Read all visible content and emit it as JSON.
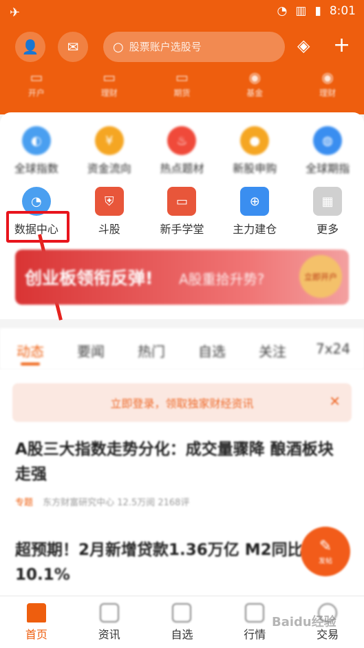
{
  "status_bar": {
    "time": "8:01"
  },
  "header": {
    "search_placeholder": "股票账户选股号"
  },
  "sub_nav": [
    {
      "label": "开户",
      "icon": "account-icon"
    },
    {
      "label": "理财",
      "icon": "wallet-icon"
    },
    {
      "label": "期货",
      "icon": "chart-icon"
    },
    {
      "label": "基金",
      "icon": "fund-icon"
    },
    {
      "label": "理财",
      "icon": "finance-icon"
    }
  ],
  "grid_row1": [
    {
      "label": "全球指数",
      "icon": "globe-chart-icon",
      "color": "#4a9ff0"
    },
    {
      "label": "资金流向",
      "icon": "money-flow-icon",
      "color": "#f5a623"
    },
    {
      "label": "热点题材",
      "icon": "fire-icon",
      "color": "#f04a3a"
    },
    {
      "label": "新股申购",
      "icon": "ipo-icon",
      "color": "#f5a623"
    },
    {
      "label": "全球期指",
      "icon": "globe-icon",
      "color": "#3a8ef0"
    }
  ],
  "grid_row2": [
    {
      "label": "数据中心",
      "icon": "pie-chart-icon",
      "color": "#4a9ff0"
    },
    {
      "label": "斗股",
      "icon": "shield-icon",
      "color": "#e8563a"
    },
    {
      "label": "新手学堂",
      "icon": "screen-icon",
      "color": "#e8563a"
    },
    {
      "label": "主力建仓",
      "icon": "position-icon",
      "color": "#3a8ef0"
    },
    {
      "label": "更多",
      "icon": "grid-icon",
      "color": "#cccccc"
    }
  ],
  "banner": {
    "headline": "创业板领衔反弹!",
    "subline": "A股重拾升势?",
    "badge": "立即开户"
  },
  "tabs": [
    "动态",
    "要闻",
    "热门",
    "自选",
    "关注",
    "7x24"
  ],
  "active_tab": "动态",
  "login_prompt": "立即登录，领取独家财经资讯",
  "news": [
    {
      "title": "A股三大指数走势分化：成交量骤降 酿酒板块走强",
      "tag": "专题",
      "meta": "东方财富研究中心 12.5万阅 2168评"
    },
    {
      "title": "超预期！2月新增贷款1.36万亿 M2同比增长10.1%",
      "tag": "",
      "meta": ""
    }
  ],
  "fab_label": "发帖",
  "bottom_nav": [
    {
      "label": "首页",
      "icon": "home-icon"
    },
    {
      "label": "资讯",
      "icon": "news-icon"
    },
    {
      "label": "自选",
      "icon": "watchlist-icon"
    },
    {
      "label": "行情",
      "icon": "market-icon"
    },
    {
      "label": "交易",
      "icon": "trade-icon"
    }
  ],
  "watermark": "Baidu经验",
  "colors": {
    "brand_orange": "#ee5e0e",
    "highlight_red": "#e8141c"
  }
}
